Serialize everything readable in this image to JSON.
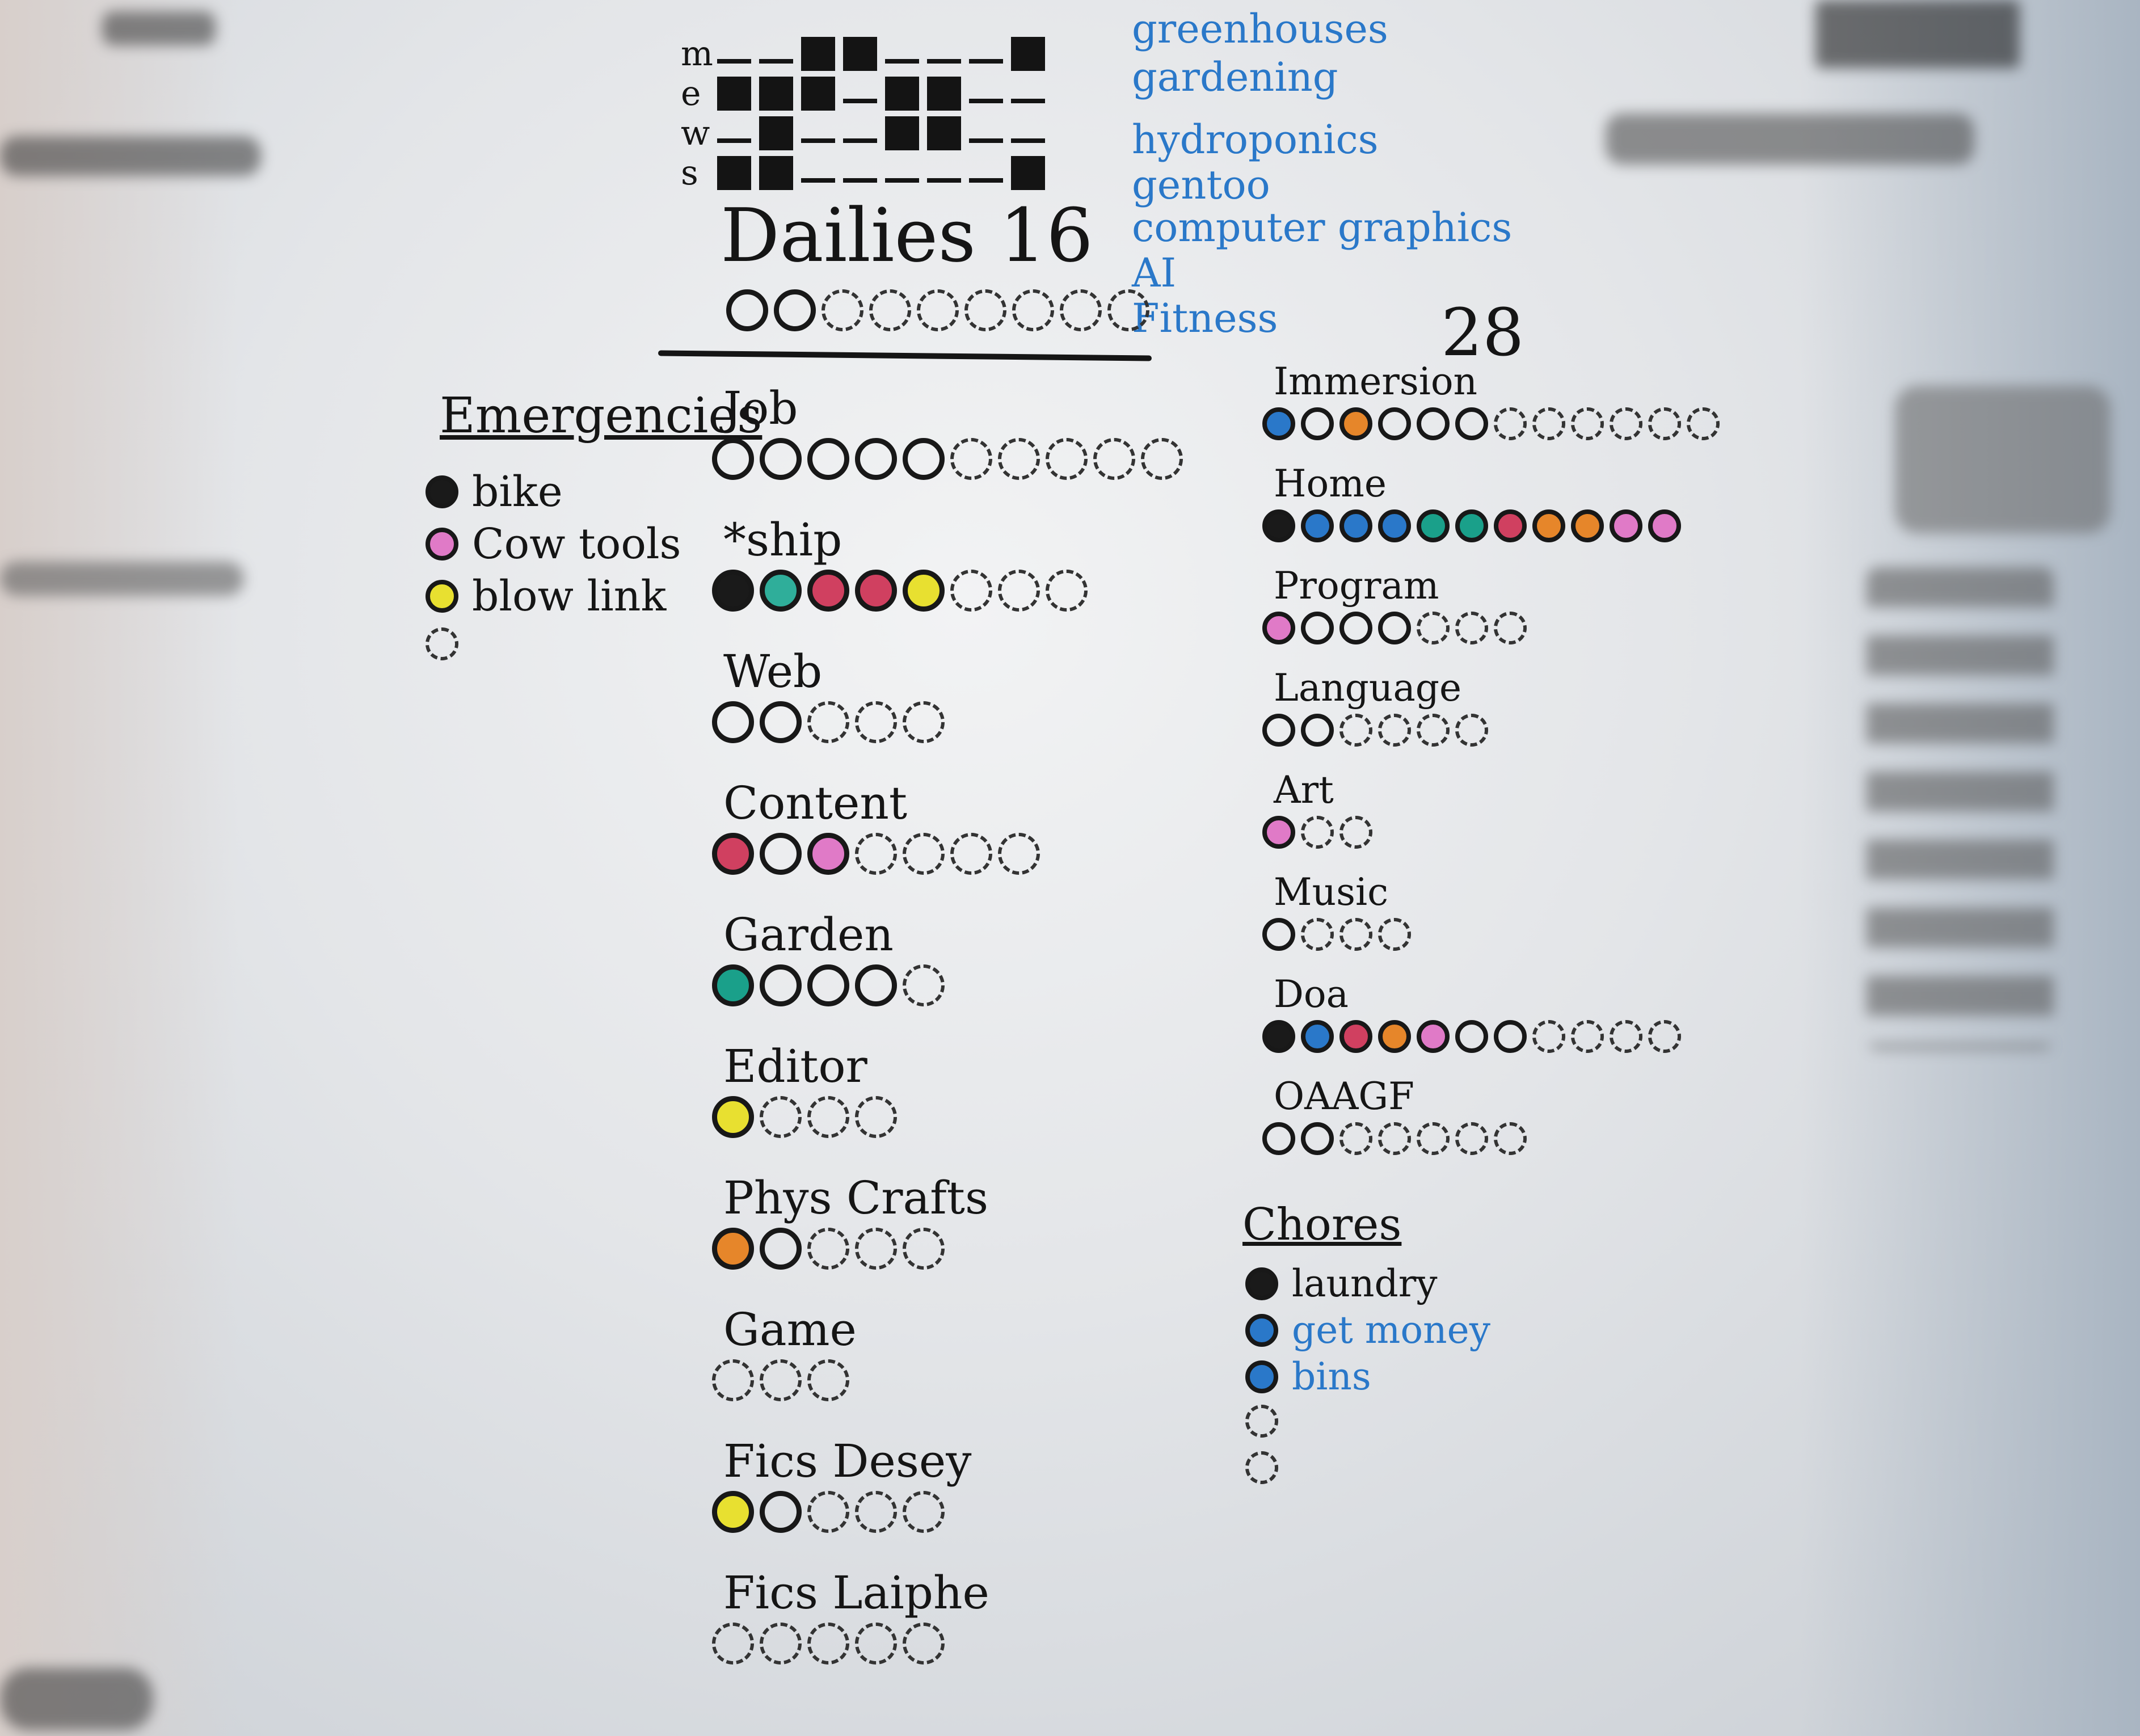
{
  "week": {
    "letters": [
      "m",
      "e",
      "w",
      "s"
    ],
    "rows": [
      [
        0,
        0,
        1,
        1,
        0,
        0,
        0,
        1
      ],
      [
        1,
        1,
        1,
        0,
        1,
        1,
        0,
        0
      ],
      [
        0,
        1,
        0,
        0,
        1,
        1,
        0,
        0
      ],
      [
        1,
        1,
        0,
        0,
        0,
        0,
        0,
        1
      ]
    ]
  },
  "topics": [
    "greenhouses",
    "gardening",
    "hydroponics",
    "gentoo",
    "computer graphics",
    "AI",
    "Fitness"
  ],
  "dailies": {
    "label": "Dailies 16",
    "dots": 9
  },
  "total_label": "28",
  "emergencies": {
    "title": "Emergencies",
    "items": [
      {
        "label": "bike",
        "color": "#1a1a1a"
      },
      {
        "label": "Cow tools",
        "color": "#e07ac7"
      },
      {
        "label": "blow link",
        "color": "#e8e030"
      },
      {
        "label": "",
        "color": ""
      }
    ]
  },
  "categories_mid": [
    {
      "title": "Job",
      "dots": [
        "o",
        "o",
        "o",
        "o",
        "o",
        "d",
        "d",
        "d",
        "d",
        "d"
      ]
    },
    {
      "title": "*ship",
      "dots": [
        "#1a1a1a",
        "#2fae9a",
        "#d04060",
        "#d04060",
        "#e8e030",
        "d",
        "d",
        "d"
      ]
    },
    {
      "title": "Web",
      "dots": [
        "o",
        "o",
        "d",
        "d",
        "d"
      ]
    },
    {
      "title": "Content",
      "dots": [
        "#d04060",
        "o",
        "#e07ac7",
        "d",
        "d",
        "d",
        "d"
      ]
    },
    {
      "title": "Garden",
      "dots": [
        "#1aa08a",
        "o",
        "o",
        "o",
        "d"
      ]
    },
    {
      "title": "Editor",
      "dots": [
        "#e8e030",
        "d",
        "d",
        "d"
      ]
    },
    {
      "title": "Phys Crafts",
      "dots": [
        "#e6862a",
        "o",
        "d",
        "d",
        "d"
      ]
    },
    {
      "title": "Game",
      "dots": [
        "d",
        "d",
        "d"
      ]
    },
    {
      "title": "Fics Desey",
      "dots": [
        "#e8e030",
        "o",
        "d",
        "d",
        "d"
      ]
    },
    {
      "title": "Fics Laiphe",
      "dots": [
        "d",
        "d",
        "d",
        "d",
        "d"
      ]
    }
  ],
  "categories_right": [
    {
      "title": "Immersion",
      "dots": [
        "#2a78c9",
        "o",
        "#e6862a",
        "o",
        "o",
        "o",
        "d",
        "d",
        "d",
        "d",
        "d",
        "d"
      ]
    },
    {
      "title": "Home",
      "dots": [
        "#1a1a1a",
        "#2a78c9",
        "#2a78c9",
        "#2a78c9",
        "#1aa08a",
        "#1aa08a",
        "#d04060",
        "#e6862a",
        "#e6862a",
        "#e07ac7",
        "#e07ac7"
      ]
    },
    {
      "title": "Program",
      "dots": [
        "#e07ac7",
        "o",
        "o",
        "o",
        "d",
        "d",
        "d"
      ]
    },
    {
      "title": "Language",
      "dots": [
        "o",
        "o",
        "d",
        "d",
        "d",
        "d"
      ]
    },
    {
      "title": "Art",
      "dots": [
        "#e07ac7",
        "d",
        "d"
      ]
    },
    {
      "title": "Music",
      "dots": [
        "o",
        "d",
        "d",
        "d"
      ]
    },
    {
      "title": "Doa",
      "dots": [
        "#1a1a1a",
        "#2a78c9",
        "#d04060",
        "#e6862a",
        "#e07ac7",
        "o",
        "o",
        "d",
        "d",
        "d",
        "d"
      ]
    },
    {
      "title": "OAAGF",
      "dots": [
        "o",
        "o",
        "d",
        "d",
        "d",
        "d",
        "d"
      ]
    }
  ],
  "chores": {
    "title": "Chores",
    "items": [
      {
        "label": "laundry",
        "color": "#1a1a1a",
        "text_color": "#151515"
      },
      {
        "label": "get money",
        "color": "#2a78c9",
        "text_color": "#2a78c9"
      },
      {
        "label": "bins",
        "color": "#2a78c9",
        "text_color": "#2a78c9"
      },
      {
        "label": "",
        "color": "",
        "text_color": "#151515"
      },
      {
        "label": "",
        "color": "",
        "text_color": "#151515"
      }
    ]
  }
}
